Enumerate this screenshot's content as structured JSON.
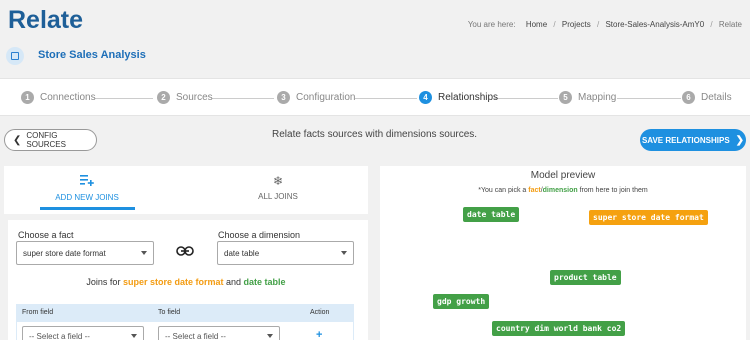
{
  "header": {
    "title": "Relate",
    "breadcrumb": {
      "prefix": "You are here:",
      "items": [
        "Home",
        "Projects",
        "Store-Sales-Analysis-AmY0",
        "Relate"
      ]
    }
  },
  "project": {
    "name": "Store Sales Analysis"
  },
  "stepper": {
    "steps": [
      {
        "num": "1",
        "label": "Connections"
      },
      {
        "num": "2",
        "label": "Sources"
      },
      {
        "num": "3",
        "label": "Configuration"
      },
      {
        "num": "4",
        "label": "Relationships"
      },
      {
        "num": "5",
        "label": "Mapping"
      },
      {
        "num": "6",
        "label": "Details"
      }
    ],
    "active_step": 4
  },
  "actions": {
    "back_label": "CONFIG SOURCES",
    "info_text": "Relate facts sources with dimensions sources.",
    "save_label": "SAVE RELATIONSHIPS"
  },
  "tabs": [
    {
      "label": "ADD NEW JOINS",
      "active": true
    },
    {
      "label": "ALL JOINS",
      "active": false
    }
  ],
  "form": {
    "fact_label": "Choose a fact",
    "fact_value": "super store date format",
    "dimension_label": "Choose a dimension",
    "dimension_value": "date table",
    "joins_prefix": "Joins for",
    "joins_fact": "super store date format",
    "joins_and": "and",
    "joins_dimension": "date table"
  },
  "join_table": {
    "headers": [
      "From field",
      "To field",
      "Action"
    ],
    "from_placeholder": "-- Select a field --",
    "to_placeholder": "-- Select a field --",
    "add_symbol": "+"
  },
  "model_preview": {
    "title": "Model preview",
    "hint_prefix": "*You can pick a",
    "hint_fact": "fact",
    "hint_slash": "/",
    "hint_dimension": "dimension",
    "hint_suffix": "from here to join them",
    "nodes": [
      {
        "label": "date table",
        "kind": "dimension"
      },
      {
        "label": "super store date format",
        "kind": "fact"
      },
      {
        "label": "product table",
        "kind": "dimension"
      },
      {
        "label": "gdp growth",
        "kind": "dimension"
      },
      {
        "label": "country dim world bank co2",
        "kind": "dimension"
      }
    ]
  },
  "colors": {
    "accent": "#1e90e0",
    "title": "#1e5f98",
    "fact": "#f5a10f",
    "dimension": "#43a047"
  }
}
